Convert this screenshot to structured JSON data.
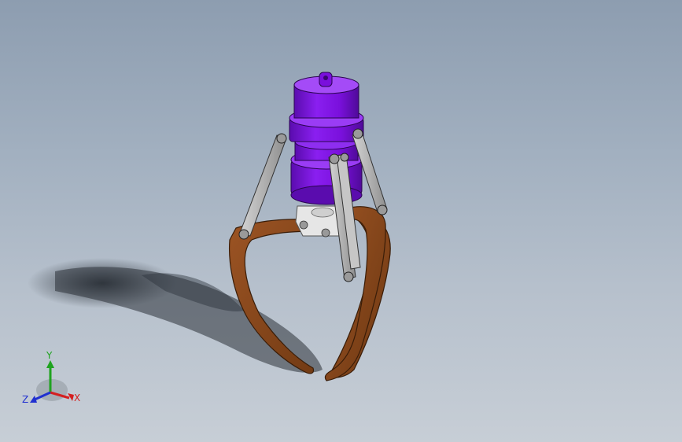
{
  "viewport": {
    "background_top": "#8d9db0",
    "background_bottom": "#c7ced6"
  },
  "model": {
    "colors": {
      "cylinder": "#7a0fd6",
      "cylinder_shadow": "#4c0a8f",
      "fingers": "#8a4a1c",
      "finger_shadow": "#5e2f0f",
      "links": "#b8b8b8",
      "link_outline": "#3a3a3a",
      "mount_block": "#e3e3e3",
      "shadow": "#2a2f36"
    }
  },
  "triad": {
    "x_label": "X",
    "y_label": "Y",
    "z_label": "Z",
    "colors": {
      "x": "#d42020",
      "y": "#1fa31f",
      "z": "#2030d0"
    }
  }
}
